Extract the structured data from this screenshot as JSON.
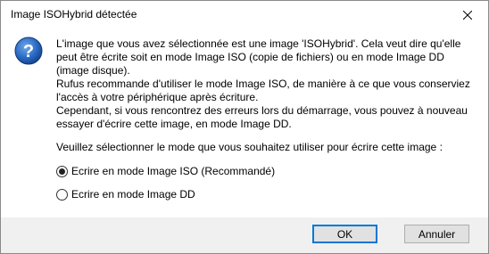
{
  "window": {
    "title": "Image ISOHybrid détectée"
  },
  "icons": {
    "dialog": "question-icon",
    "close": "close-icon"
  },
  "message": {
    "lines": [
      "L'image que vous avez sélectionnée est une image 'ISOHybrid'. Cela veut dire qu'elle peut être écrite soit en mode Image ISO (copie de fichiers) ou en mode Image DD (image disque).",
      "Rufus recommande d'utiliser le mode Image ISO, de manière à ce que vous conserviez l'accès à votre périphérique après écriture.",
      "Cependant, si vous rencontrez des erreurs lors du démarrage, vous pouvez à nouveau essayer d'écrire cette image, en mode Image DD."
    ],
    "prompt": "Veuillez sélectionner le mode que vous souhaitez utiliser pour écrire cette image :"
  },
  "options": [
    {
      "label": "Ecrire en mode Image ISO (Recommandé)",
      "selected": true
    },
    {
      "label": "Ecrire en mode Image DD",
      "selected": false
    }
  ],
  "buttons": {
    "ok": "OK",
    "cancel": "Annuler"
  },
  "colors": {
    "icon_blue": "#1f5fb0",
    "accent": "#0078d7",
    "footer_bg": "#f0f0f0"
  }
}
